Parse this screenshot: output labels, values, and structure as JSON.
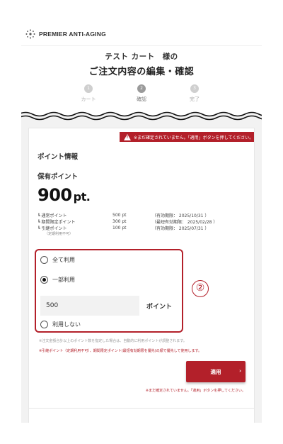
{
  "header": {
    "brand": "PREMIER ANTI-AGING",
    "customer_line": "テスト カート　様の",
    "title": "ご注文内容の編集・確認"
  },
  "steps": [
    {
      "number": "1",
      "label": "カート",
      "active": false
    },
    {
      "number": "2",
      "label": "確認",
      "active": true
    },
    {
      "number": "3",
      "label": "完了",
      "active": false
    }
  ],
  "warning_banner": "※まだ確定されていません。「適用」ボタンを押してください。",
  "points_section": {
    "title": "ポイント情報",
    "held_label": "保有ポイント",
    "held_value": "900",
    "held_unit": "pt.",
    "breakdown": [
      {
        "name": "┗ 通常ポイント",
        "points": "500 pt",
        "expiry": "（有効期限： 2025/10/31 ）"
      },
      {
        "name": "┗ 期間限定ポイント",
        "points": "300 pt",
        "expiry": "（最短有効期限： 2025/02/28 ）"
      },
      {
        "name": "┗ 引継ポイント",
        "points": "100 pt",
        "expiry": "（有効期限： 2025/07/31 ）"
      }
    ],
    "carryover_note": "（定期利用不可）"
  },
  "usage_options": {
    "all": "全て利用",
    "partial": "一部利用",
    "none": "利用しない",
    "selected": "partial",
    "input_value": "500",
    "input_unit": "ポイント"
  },
  "callout": "②",
  "notes": {
    "auto_adjust": "※注文金額合計以上のポイント数を指定した場合は、自動的に利用ポイントが調整されます。",
    "usage_order": "※引継ポイント（定期利用不可）、期間限定ポイント(最短有効期限を優先)の順で優先して使用します。",
    "bottom_warning": "※まだ確定されていません。「適用」ボタンを押してください。"
  },
  "apply_button": {
    "label": "適用",
    "chevron": "›"
  },
  "colors": {
    "accent": "#b3202a",
    "background_gray": "#f2f2f2"
  }
}
